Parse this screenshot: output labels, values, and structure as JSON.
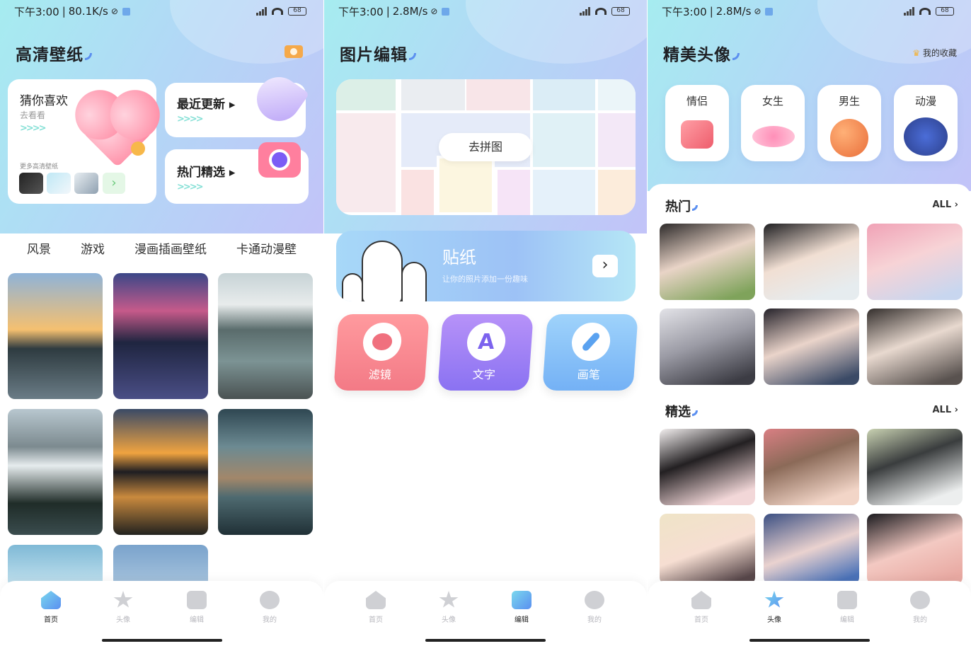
{
  "status_bars": [
    {
      "time": "下午3:00",
      "speed": "80.1K/s",
      "battery": "68"
    },
    {
      "time": "下午3:00",
      "speed": "2.8M/s",
      "battery": "68"
    },
    {
      "time": "下午3:00",
      "speed": "2.8M/s",
      "battery": "68"
    }
  ],
  "wallpaper": {
    "title": "高清壁纸",
    "guess_card": {
      "title": "猜你喜欢",
      "subtitle": "去看看",
      "arrows": ">>>>",
      "more_label": "更多高清壁纸"
    },
    "recent_card": {
      "title": "最近更新",
      "arrows": ">>>>"
    },
    "hot_card": {
      "title": "热门精选",
      "arrows": ">>>>"
    },
    "tabs": [
      "风景",
      "游戏",
      "漫画插画壁纸",
      "卡通动漫壁"
    ]
  },
  "editor": {
    "title": "图片编辑",
    "collage_button": "去拼图",
    "sticker_banner": {
      "title": "贴纸",
      "subtitle": "让你的照片添加一份趣味"
    },
    "tools": [
      {
        "label": "滤镜",
        "icon": "filter-icon"
      },
      {
        "label": "文字",
        "icon": "text-icon",
        "glyph": "A"
      },
      {
        "label": "画笔",
        "icon": "brush-icon"
      }
    ]
  },
  "avatars": {
    "title": "精美头像",
    "favorites_label": "我的收藏",
    "categories": [
      "情侣",
      "女生",
      "男生",
      "动漫"
    ],
    "hot_section": {
      "title": "热门",
      "all_label": "ALL"
    },
    "featured_section": {
      "title": "精选",
      "all_label": "ALL"
    }
  },
  "navigation": {
    "items": [
      "首页",
      "头像",
      "编辑",
      "我的"
    ],
    "active": [
      "首页",
      "编辑",
      "头像"
    ]
  },
  "colors": {
    "accent": "#5a8ff0",
    "gradient_start": "#a6ecf0",
    "gradient_end": "#c2c3f8"
  }
}
